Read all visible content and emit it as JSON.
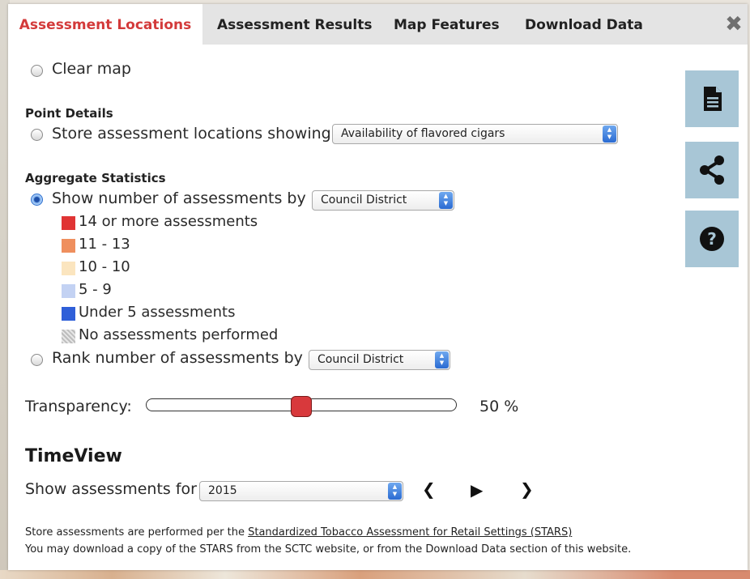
{
  "tabs": [
    {
      "label": "Assessment Locations",
      "active": true
    },
    {
      "label": "Assessment Results",
      "active": false
    },
    {
      "label": "Map Features",
      "active": false
    },
    {
      "label": "Download Data",
      "active": false
    }
  ],
  "close_icon": "close-x-icon",
  "clear_map_label": "Clear map",
  "point_details": {
    "heading": "Point Details",
    "radio_label": "Store assessment locations showing",
    "select_value": "Availability of flavored cigars"
  },
  "aggregate": {
    "heading": "Aggregate Statistics",
    "show_label": "Show number of assessments by",
    "show_select": "Council District",
    "legend": [
      {
        "label": "14 or more assessments",
        "color": "#e03434"
      },
      {
        "label": "11 - 13",
        "color": "#ef8f5e"
      },
      {
        "label": "10 - 10",
        "color": "#fbe5bf"
      },
      {
        "label": "5 - 9",
        "color": "#c3d2f3"
      },
      {
        "label": "Under 5 assessments",
        "color": "#2f5fd8"
      },
      {
        "label": "No assessments performed",
        "color": "pattern-gray"
      }
    ],
    "rank_label": "Rank number of assessments by",
    "rank_select": "Council District"
  },
  "transparency": {
    "label": "Transparency:",
    "value_text": "50 %",
    "value": 0.5
  },
  "timeview": {
    "heading": "TimeView",
    "label": "Show assessments for",
    "year": "2015"
  },
  "footer": {
    "line1_prefix": "Store assessments are performed per the ",
    "line1_link": "Standardized Tobacco Assessment for Retail Settings (STARS)",
    "line2": "You may download a copy of the STARS from the SCTC website, or from the Download Data section of this website."
  },
  "side_buttons": [
    "document-icon",
    "share-icon",
    "help-icon"
  ],
  "colors": {
    "accent": "#d33a3a",
    "side_button": "#a8c6d6",
    "slider_thumb": "#d8393c"
  }
}
